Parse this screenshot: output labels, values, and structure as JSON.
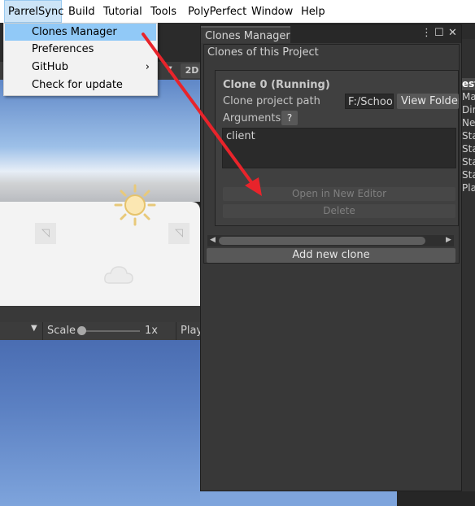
{
  "menubar": {
    "items": [
      "ParrelSync",
      "Build",
      "Tutorial",
      "Tools",
      "PolyPerfect",
      "Window",
      "Help"
    ]
  },
  "dropdown": {
    "items": [
      "Clones Manager",
      "Preferences",
      "GitHub",
      "Check for update"
    ],
    "highlighted": "Clones Manager",
    "submenu_icon": "chevron-right-icon"
  },
  "scene": {
    "mode_2d": "2D",
    "sun_icon": "sun-icon",
    "cloud_icon": "cloud-icon"
  },
  "game_toolbar": {
    "scale_label": "Scale",
    "scale_value": "1x",
    "play_label": "Play",
    "scale_slider_value": 0.0
  },
  "hierarchy": {
    "header": "est",
    "lines": [
      "Ma",
      "Dir",
      "Ne",
      "Sta",
      "Sta",
      "Sta",
      "Sta",
      "Pla"
    ]
  },
  "panel": {
    "tab_title": "Clones Manager",
    "section_title": "Clones of this Project",
    "clone_title": "Clone 0 (Running)",
    "path_label": "Clone project path",
    "path_value": "F:/School",
    "view_folder": "View Folder",
    "arguments_label": "Arguments",
    "help": "?",
    "arguments_value": "client",
    "open_editor": "Open in New Editor",
    "delete": "Delete",
    "add_clone": "Add new clone",
    "menu_icon": "⋮",
    "maximize_icon": "☐",
    "close_icon": "✕"
  },
  "annotation": {
    "color": "#e8242b"
  }
}
